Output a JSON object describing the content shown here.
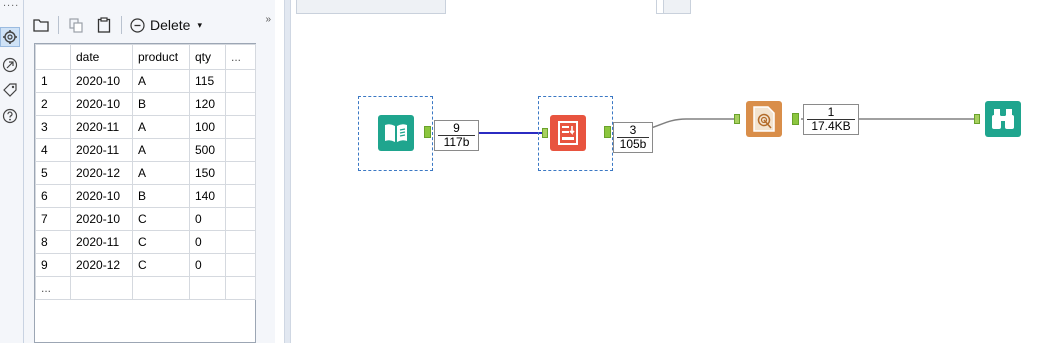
{
  "toolbar": {
    "delete_label": "Delete",
    "caret": "▾",
    "overflow": "»",
    "more_dots": "...."
  },
  "grid": {
    "headers": [
      "",
      "date",
      "product",
      "qty",
      "..."
    ],
    "rows": [
      {
        "idx": "1",
        "date": "2020-10",
        "product": "A",
        "qty": "115"
      },
      {
        "idx": "2",
        "date": "2020-10",
        "product": "B",
        "qty": "120"
      },
      {
        "idx": "3",
        "date": "2020-11",
        "product": "A",
        "qty": "100"
      },
      {
        "idx": "4",
        "date": "2020-11",
        "product": "A",
        "qty": "500"
      },
      {
        "idx": "5",
        "date": "2020-12",
        "product": "A",
        "qty": "150"
      },
      {
        "idx": "6",
        "date": "2020-10",
        "product": "B",
        "qty": "140"
      },
      {
        "idx": "7",
        "date": "2020-10",
        "product": "C",
        "qty": "0"
      },
      {
        "idx": "8",
        "date": "2020-11",
        "product": "C",
        "qty": "0"
      },
      {
        "idx": "9",
        "date": "2020-12",
        "product": "C",
        "qty": "0"
      }
    ],
    "footer": "..."
  },
  "workflow": {
    "connections": [
      {
        "records": "9",
        "size": "117b"
      },
      {
        "records": "3",
        "size": "105b"
      },
      {
        "records": "1",
        "size": "17.4KB"
      }
    ],
    "tools": [
      {
        "name": "input-data-tool-icon",
        "color": "#1fa58e"
      },
      {
        "name": "summarize-tool-icon",
        "color": "#e8543f"
      },
      {
        "name": "render-tool-icon",
        "color": "#d98e4a"
      },
      {
        "name": "browse-tool-icon",
        "color": "#1fa58e"
      }
    ]
  },
  "colors": {
    "link_selected": "#2b2bc2",
    "link_default": "#808080",
    "anchor": "#8cc63f"
  }
}
